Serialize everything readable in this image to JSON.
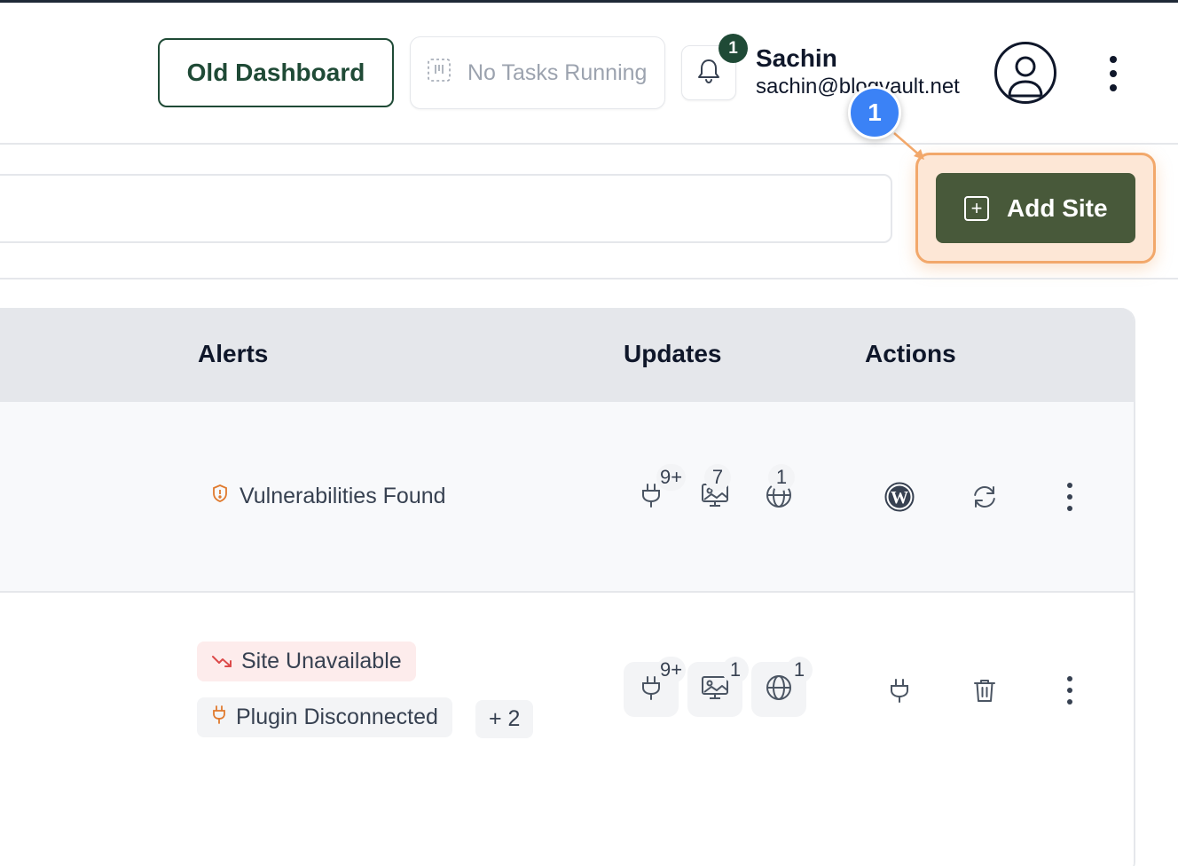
{
  "header": {
    "old_dashboard_label": "Old Dashboard",
    "tasks_label": "No Tasks Running",
    "notification_count": "1",
    "user_name": "Sachin",
    "user_email": "sachin@blogvault.net"
  },
  "toolbar": {
    "search_placeholder": "",
    "add_site_label": "Add Site"
  },
  "tutorial": {
    "step_number": "1"
  },
  "table": {
    "columns": [
      "Alerts",
      "Updates",
      "Actions"
    ],
    "rows": [
      {
        "alerts": [
          {
            "label": "Vulnerabilities Found",
            "icon": "shield-alert-icon"
          }
        ],
        "updates": {
          "plugins": "9+",
          "themes": "7",
          "core": "1"
        },
        "actions": [
          "wordpress-icon",
          "refresh-icon",
          "more-icon"
        ]
      },
      {
        "alerts": [
          {
            "label": "Site Unavailable",
            "icon": "trending-down-icon"
          },
          {
            "label": "Plugin Disconnected",
            "icon": "plug-icon"
          }
        ],
        "more_alerts": "+ 2",
        "updates": {
          "plugins": "9+",
          "themes": "1",
          "core": "1"
        },
        "actions": [
          "plug-icon",
          "trash-icon",
          "more-icon"
        ]
      }
    ]
  },
  "colors": {
    "brand_green": "#1f4a36",
    "add_button": "#48593a",
    "highlight": "#f2a86b",
    "step_badge": "#3b82f6",
    "alert_orange": "#e07a2e",
    "alert_red": "#dc4a4a"
  }
}
